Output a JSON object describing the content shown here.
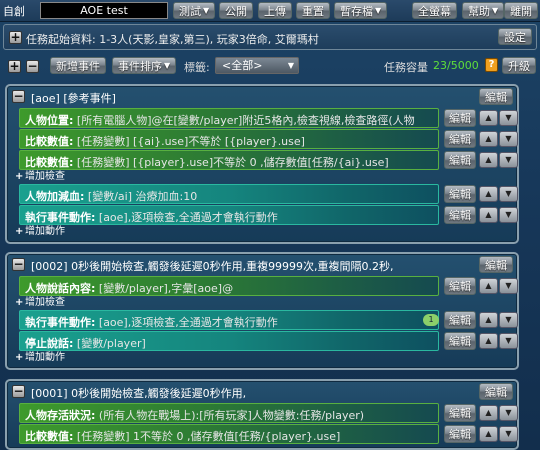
{
  "top": {
    "mode": "自創",
    "title": "AOE test",
    "buttons": [
      "測試",
      "公開",
      "上傳",
      "重置",
      "暫存檔",
      "全螢幕",
      "幫助",
      "離開"
    ]
  },
  "info": {
    "text": "任務起始資料: 1-3人(天影,皇家,第三), 玩家3倍命, 艾爾瑪村",
    "settings_label": "設定"
  },
  "toolbar": {
    "add_event": "新增事件",
    "sort_event": "事件排序",
    "tag_label": "標籤:",
    "tag_value": "<全部>",
    "capacity_label": "任務容量",
    "capacity_value": "23/5000",
    "upgrade": "升級",
    "help": "?"
  },
  "labels": {
    "edit": "編輯",
    "add_check": "增加檢查",
    "add_action": "增加動作"
  },
  "events": [
    {
      "title": "[aoe] [參考事件]",
      "rows": [
        {
          "label": "人物位置:",
          "text": " [所有電腦人物]@在[變數/player]附近5格內,檢查視線,檢查路徑(人物",
          "teal": false
        },
        {
          "label": "比較數值:",
          "text": " [任務變數] [{ai}.use]不等於 [{player}.use]",
          "teal": false
        },
        {
          "label": "比較數值:",
          "text": " [任務變數] [{player}.use]不等於 0 ,儲存數值[任務/{ai}.use]",
          "teal": false
        },
        {
          "add": "check"
        },
        {
          "label": "人物加減血:",
          "text": " [變數/ai] 治療加血:10",
          "teal": true
        },
        {
          "label": "執行事件動作:",
          "text": " [aoe],逐項檢查,全通過才會執行動作",
          "teal": true
        },
        {
          "add": "action"
        }
      ]
    },
    {
      "title": "[0002] 0秒後開始檢查,觸發後延遲0秒作用,重複99999次,重複間隔0.2秒,",
      "rows": [
        {
          "label": "人物說話內容:",
          "text": " [變數/player],字彙[aoe]@",
          "teal": false
        },
        {
          "add": "check"
        },
        {
          "label": "執行事件動作:",
          "text": " [aoe],逐項檢查,全通過才會執行動作",
          "teal": true,
          "badge": "1"
        },
        {
          "label": "停止說話:",
          "text": " [變數/player]",
          "teal": true
        },
        {
          "add": "action"
        }
      ]
    },
    {
      "title": "[0001] 0秒後開始檢查,觸發後延遲0秒作用,",
      "rows": [
        {
          "label": "人物存活狀況:",
          "text": " (所有人物在戰場上):[所有玩家]人物變數:任務/player)",
          "teal": false
        },
        {
          "label": "比較數值:",
          "text": " [任務變數] 1不等於 0 ,儲存數值[任務/{player}.use]",
          "teal": false
        }
      ]
    }
  ]
}
